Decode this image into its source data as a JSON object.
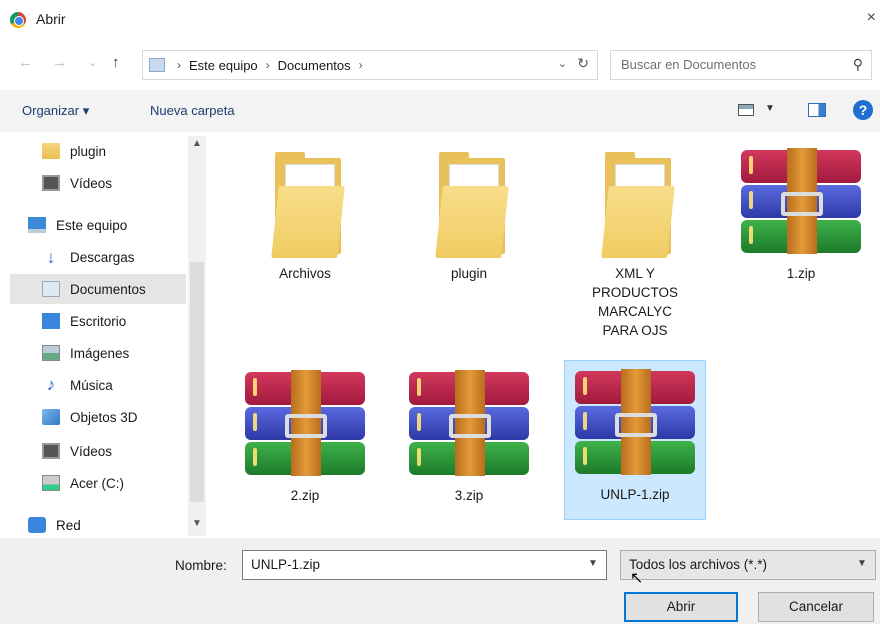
{
  "window": {
    "title": "Abrir",
    "close_glyph": "×"
  },
  "nav": {
    "back_glyph": "←",
    "forward_glyph": "→",
    "recent_glyph": "⌄",
    "up_glyph": "↑",
    "breadcrumb": [
      "Este equipo",
      "Documentos"
    ],
    "separator": "›",
    "refresh_glyph": "↻",
    "dropdown_glyph": "⌄"
  },
  "search": {
    "placeholder": "Buscar en Documentos",
    "icon": "search-icon"
  },
  "toolbar": {
    "organize_label": "Organizar ▾",
    "new_folder_label": "Nueva carpeta",
    "help_label": "?"
  },
  "sidebar": {
    "items": [
      {
        "label": "plugin",
        "icon": "folder-icon"
      },
      {
        "label": "Vídeos",
        "icon": "video-icon"
      },
      {
        "label": "Este equipo",
        "icon": "computer-icon"
      },
      {
        "label": "Descargas",
        "icon": "download-icon"
      },
      {
        "label": "Documentos",
        "icon": "documents-icon",
        "selected": true
      },
      {
        "label": "Escritorio",
        "icon": "desktop-icon"
      },
      {
        "label": "Imágenes",
        "icon": "pictures-icon"
      },
      {
        "label": "Música",
        "icon": "music-icon"
      },
      {
        "label": "Objetos 3D",
        "icon": "3d-objects-icon"
      },
      {
        "label": "Vídeos",
        "icon": "video-icon"
      },
      {
        "label": "Acer (C:)",
        "icon": "drive-icon"
      },
      {
        "label": "Red",
        "icon": "network-icon"
      }
    ]
  },
  "files": [
    {
      "name": "Archivos",
      "type": "folder"
    },
    {
      "name": "plugin",
      "type": "folder"
    },
    {
      "name": "XML Y PRODUCTOS MARCALYC PARA OJS",
      "type": "folder"
    },
    {
      "name": "1.zip",
      "type": "winrar"
    },
    {
      "name": "2.zip",
      "type": "winrar"
    },
    {
      "name": "3.zip",
      "type": "winrar"
    },
    {
      "name": "UNLP-1.zip",
      "type": "winrar",
      "selected": true
    }
  ],
  "footer": {
    "name_label": "Nombre:",
    "name_value": "UNLP-1.zip",
    "filter_value": "Todos los archivos (*.*)",
    "open_label": "Abrir",
    "cancel_label": "Cancelar"
  },
  "colors": {
    "selection": "#cce8ff",
    "accent": "#0078d7",
    "help": "#1f6fd1"
  }
}
